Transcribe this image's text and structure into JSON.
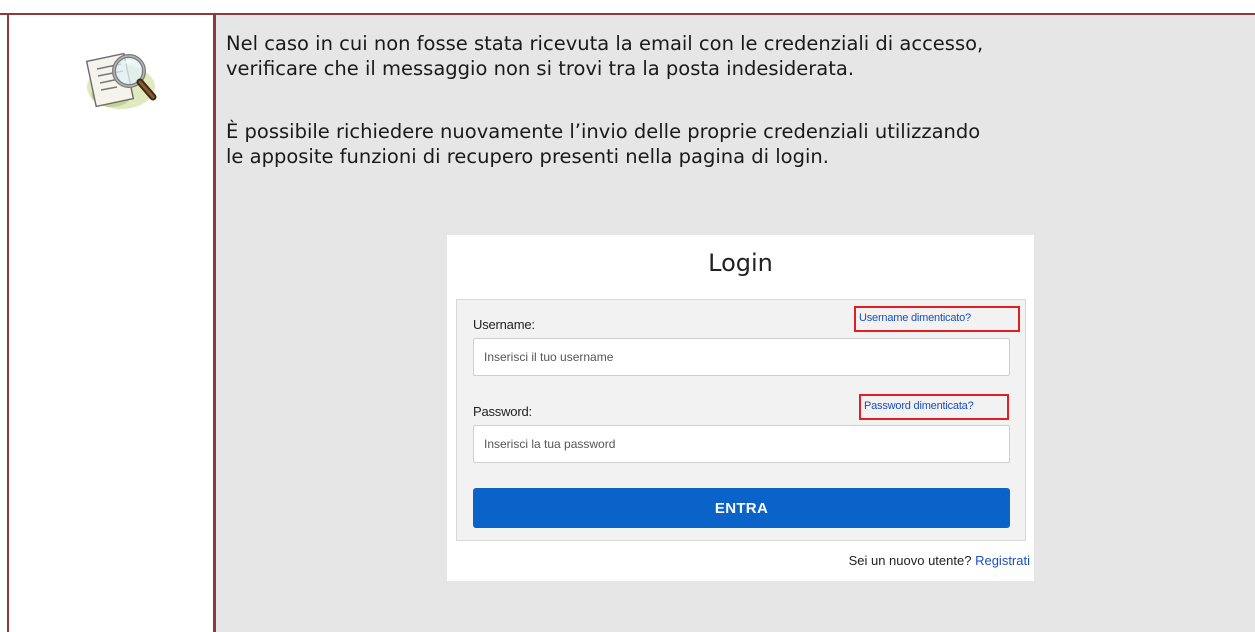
{
  "note": {
    "icon": "magnifier-document-icon",
    "paragraph_1": {
      "line_1": "Nel caso in cui non fosse stata ricevuta la email con le credenziali di accesso,",
      "line_2": "verificare che il messaggio non si trovi tra la posta indesiderata."
    },
    "paragraph_2": {
      "line_1": "È possibile richiedere nuovamente l’invio delle proprie credenziali utilizzando",
      "line_2": "le apposite funzioni di recupero presenti nella pagina di login."
    }
  },
  "login": {
    "title": "Login",
    "username": {
      "label": "Username:",
      "placeholder": "Inserisci il tuo username",
      "forgot_link": "Username dimenticato?"
    },
    "password": {
      "label": "Password:",
      "placeholder": "Inserisci la tua password",
      "forgot_link": "Password dimenticata?"
    },
    "submit_label": "ENTRA",
    "register": {
      "prompt": "Sei un nuovo utente?",
      "link": "Registrati"
    }
  },
  "colors": {
    "table_border": "#8e3a3a",
    "note_background": "#e6e6e6",
    "button_blue": "#0a63c9",
    "highlight_red": "#e02020",
    "link_blue": "#1a4fc0"
  }
}
